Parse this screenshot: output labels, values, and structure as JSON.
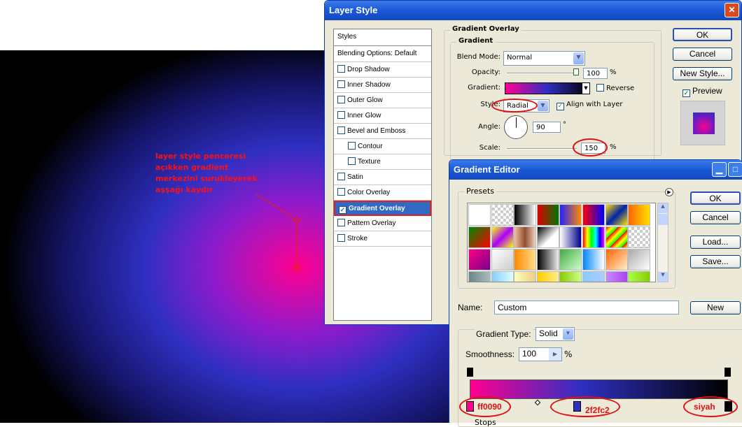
{
  "annotation": {
    "text": "layer style penceresi açıkken gradient merkezini surukleyerek aşşağı kaydır"
  },
  "layer_style": {
    "title": "Layer Style",
    "close_glyph": "✕",
    "styles_header": "Styles",
    "items": [
      {
        "label": "Blending Options: Default",
        "checkbox": false,
        "checked": false,
        "indent": false
      },
      {
        "label": "Drop Shadow",
        "checkbox": true,
        "checked": false,
        "indent": false
      },
      {
        "label": "Inner Shadow",
        "checkbox": true,
        "checked": false,
        "indent": false
      },
      {
        "label": "Outer Glow",
        "checkbox": true,
        "checked": false,
        "indent": false
      },
      {
        "label": "Inner Glow",
        "checkbox": true,
        "checked": false,
        "indent": false
      },
      {
        "label": "Bevel and Emboss",
        "checkbox": true,
        "checked": false,
        "indent": false
      },
      {
        "label": "Contour",
        "checkbox": true,
        "checked": false,
        "indent": true
      },
      {
        "label": "Texture",
        "checkbox": true,
        "checked": false,
        "indent": true
      },
      {
        "label": "Satin",
        "checkbox": true,
        "checked": false,
        "indent": false
      },
      {
        "label": "Color Overlay",
        "checkbox": true,
        "checked": false,
        "indent": false
      },
      {
        "label": "Gradient Overlay",
        "checkbox": true,
        "checked": true,
        "indent": false,
        "selected": true
      },
      {
        "label": "Pattern Overlay",
        "checkbox": true,
        "checked": false,
        "indent": false
      },
      {
        "label": "Stroke",
        "checkbox": true,
        "checked": false,
        "indent": false
      }
    ],
    "section_title": "Gradient Overlay",
    "subsection_title": "Gradient",
    "blend_mode_label": "Blend Mode:",
    "blend_mode_value": "Normal",
    "opacity_label": "Opacity:",
    "opacity_value": "100",
    "opacity_unit": "%",
    "gradient_label": "Gradient:",
    "reverse_label": "Reverse",
    "style_label": "Style:",
    "style_value": "Radial",
    "align_label": "Align with Layer",
    "angle_label": "Angle:",
    "angle_value": "90",
    "angle_unit": "°",
    "scale_label": "Scale:",
    "scale_value": "150",
    "scale_unit": "%",
    "ok": "OK",
    "cancel": "Cancel",
    "new_style": "New Style...",
    "preview_label": "Preview"
  },
  "gradient_editor": {
    "title": "Gradient Editor",
    "presets_label": "Presets",
    "ok": "OK",
    "cancel": "Cancel",
    "load": "Load...",
    "save": "Save...",
    "name_label": "Name:",
    "name_value": "Custom",
    "new_button": "New",
    "type_label": "Gradient Type:",
    "type_value": "Solid",
    "smoothness_label": "Smoothness:",
    "smoothness_value": "100",
    "smoothness_unit": "%",
    "stops_label": "Stops",
    "stop_colors": {
      "left": "#ff0090",
      "mid": "#2f2fc2",
      "right": "#000000"
    },
    "stop_notes": {
      "left": "ff0090",
      "mid": "2f2fc2",
      "right": "siyah"
    }
  }
}
